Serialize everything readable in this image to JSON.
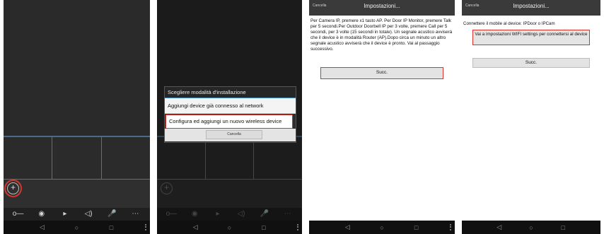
{
  "colors": {
    "highlight": "#d8342c",
    "dark_bg": "#2b2b2b",
    "accent_line": "#3c8ec7"
  },
  "toolbar_icons": [
    "key-icon",
    "camera-icon",
    "video-camera-icon",
    "speaker-icon",
    "microphone-icon",
    "more-icon"
  ],
  "nav_icons": [
    "back-icon",
    "home-icon",
    "recents-icon"
  ],
  "dialog": {
    "title": "Scegliere modalità d'installazione",
    "option_connected": "Aggiungi device già connesso al network",
    "option_configure": "Configura ed aggiungi un nuovo wireless device",
    "cancel": "Cancella"
  },
  "settings_instructions": {
    "cancel": "Cancella",
    "title": "Impostazioni...",
    "text": "Per Camera IP, premere x1 tasto AP. Per Door IP Monitor, premere Talk per 5 secondi.Per Outdoor Doorbell IP per 3 volte, premere Call per 5 secondi, per 3 volte (15 secondi in totale). Un segnale acustico avviserà che il device è in modalità Router (AP).Dopo circa un minuto un altro segnale acustico avviserà che il device è pronto. Vai al passaggio successivo.",
    "next_button": "Succ."
  },
  "settings_wifi": {
    "cancel": "Cancella",
    "title": "Impostazioni...",
    "text": "Connettere il mobile al device: IPDoor o IPCam",
    "wifi_button": "Vai a impostazioni WIFI settings per connettersi al device",
    "next_button": "Succ."
  }
}
